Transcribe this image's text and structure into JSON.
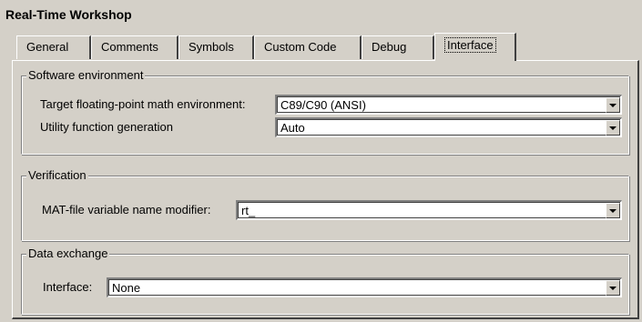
{
  "window_title": "Real-Time Workshop",
  "tabs": [
    {
      "label": "General"
    },
    {
      "label": "Comments"
    },
    {
      "label": "Symbols"
    },
    {
      "label": "Custom Code"
    },
    {
      "label": "Debug"
    },
    {
      "label": "Interface"
    }
  ],
  "active_tab": "Interface",
  "software_environment": {
    "legend": "Software environment",
    "math_env_label": "Target floating-point math environment:",
    "math_env_value": "C89/C90 (ANSI)",
    "utility_label": "Utility function generation",
    "utility_value": "Auto"
  },
  "verification": {
    "legend": "Verification",
    "mat_label": "MAT-file variable name modifier:",
    "mat_value": "rt_"
  },
  "data_exchange": {
    "legend": "Data exchange",
    "interface_label": "Interface:",
    "interface_value": "None"
  },
  "icons": {
    "dropdown": "chevron-down-icon"
  }
}
